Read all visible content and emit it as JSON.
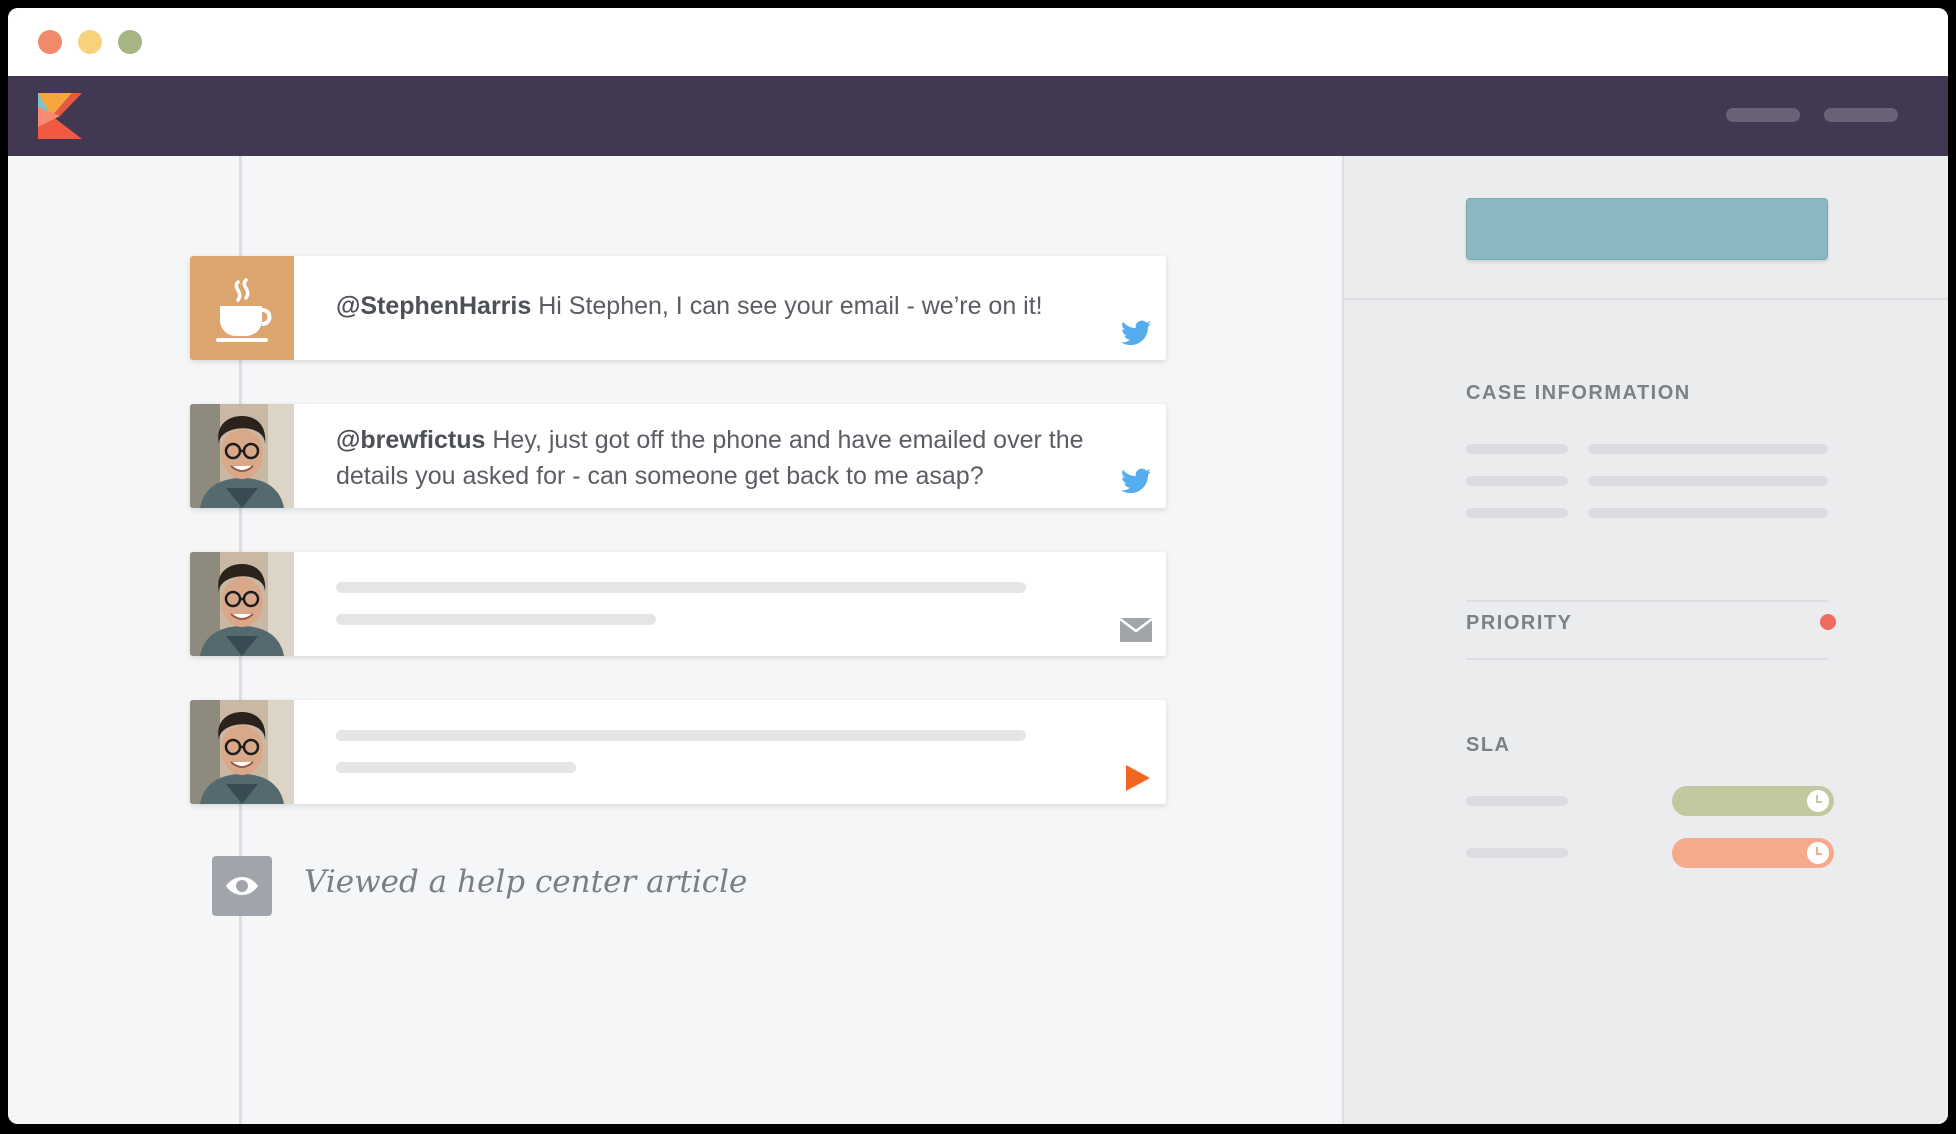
{
  "window": {
    "traffic_lights": [
      "close",
      "minimize",
      "maximize"
    ]
  },
  "colors": {
    "navbar": "#433851",
    "accent_button": "#8ab8c0",
    "twitter": "#55acee",
    "priority": "#ef6b5d",
    "sla_ok": "#c4c8a1",
    "sla_warning": "#f6a98b",
    "play": "#f26522"
  },
  "navbar": {
    "logo_icon": "kayako-logo-icon"
  },
  "timeline": {
    "posts": [
      {
        "avatar": "coffee-cup-icon",
        "handle": "@StephenHarris",
        "text": "Hi Stephen, I can see your email - we’re on it!",
        "channel": "twitter-icon"
      },
      {
        "avatar": "customer-photo",
        "handle": "@brewfictus",
        "text": "Hey, just got off the phone and have emailed over the details you asked for - can someone get back to me asap?",
        "channel": "twitter-icon"
      },
      {
        "avatar": "customer-photo",
        "handle": "",
        "text": "",
        "channel": "envelope-icon"
      },
      {
        "avatar": "customer-photo",
        "handle": "",
        "text": "",
        "channel": "play-icon"
      }
    ],
    "event": {
      "icon": "eye-icon",
      "text": "Viewed a help center article"
    }
  },
  "sidebar": {
    "case_information_title": "CASE INFORMATION",
    "priority_title": "PRIORITY",
    "sla_title": "SLA"
  }
}
